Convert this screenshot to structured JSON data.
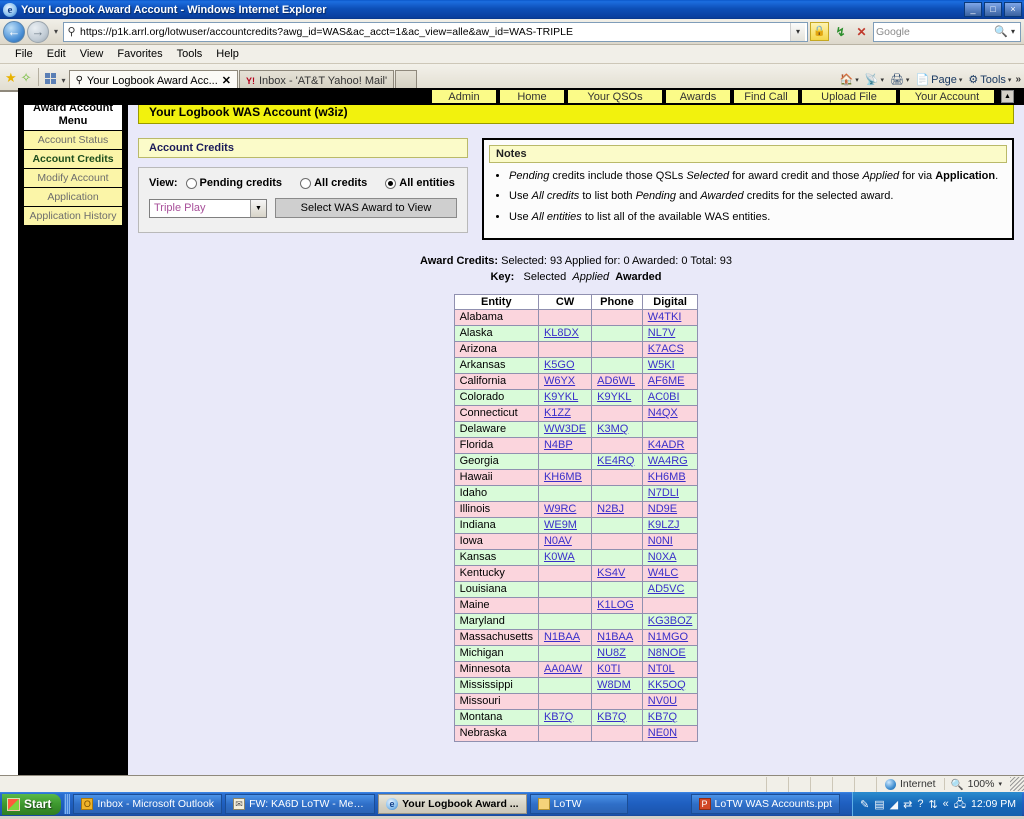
{
  "window": {
    "title": "Your Logbook Award Account - Windows Internet Explorer",
    "minimize": "_",
    "maximize": "□",
    "close": "×"
  },
  "address_bar": {
    "url": "https://p1k.arrl.org/lotwuser/accountcredits?awg_id=WAS&ac_acct=1&ac_view=alle&aw_id=WAS-TRIPLE",
    "search_placeholder": "Google"
  },
  "menu_bar": [
    "File",
    "Edit",
    "View",
    "Favorites",
    "Tools",
    "Help"
  ],
  "tabs": [
    {
      "label": "Your Logbook Award Acc...",
      "close": "✕",
      "active": true
    },
    {
      "label": "Inbox - 'AT&T Yahoo! Mail'",
      "close": "",
      "active": false
    }
  ],
  "command_bar": {
    "page_label": "Page",
    "tools_label": "Tools",
    "overflow": "»"
  },
  "nav_tabs": [
    "Admin",
    "Home",
    "Your QSOs",
    "Awards",
    "Find Call",
    "Upload File",
    "Your Account"
  ],
  "sidebar": {
    "title": "Award Account Menu",
    "items": [
      {
        "label": "Account Status",
        "current": false
      },
      {
        "label": "Account Credits",
        "current": true
      },
      {
        "label": "Modify Account",
        "current": false
      },
      {
        "label": "Application",
        "current": false
      },
      {
        "label": "Application History",
        "current": false
      }
    ]
  },
  "page_banner": "Your Logbook WAS Account (w3iz)",
  "account_credits": {
    "heading": "Account Credits",
    "view_label": "View:",
    "radios": [
      {
        "label": "Pending credits",
        "selected": false
      },
      {
        "label": "All credits",
        "selected": false
      },
      {
        "label": "All entities",
        "selected": true
      }
    ],
    "award_select_value": "Triple Play",
    "select_button": "Select WAS Award to View"
  },
  "notes": {
    "heading": "Notes",
    "items": [
      {
        "parts": [
          {
            "t": "Pending",
            "s": "i"
          },
          {
            "t": " credits include those QSLs ",
            "s": ""
          },
          {
            "t": "Selected",
            "s": "i"
          },
          {
            "t": " for award credit and those ",
            "s": ""
          },
          {
            "t": "Applied",
            "s": "i"
          },
          {
            "t": " for via ",
            "s": ""
          },
          {
            "t": "Application",
            "s": "b"
          },
          {
            "t": ".",
            "s": ""
          }
        ]
      },
      {
        "parts": [
          {
            "t": "Use ",
            "s": ""
          },
          {
            "t": "All credits",
            "s": "i"
          },
          {
            "t": " to list both ",
            "s": ""
          },
          {
            "t": "Pending",
            "s": "i"
          },
          {
            "t": " and ",
            "s": ""
          },
          {
            "t": "Awarded",
            "s": "i"
          },
          {
            "t": " credits for the selected award.",
            "s": ""
          }
        ]
      },
      {
        "parts": [
          {
            "t": "Use ",
            "s": ""
          },
          {
            "t": "All entities",
            "s": "i"
          },
          {
            "t": " to list all of the available WAS entities.",
            "s": ""
          }
        ]
      }
    ]
  },
  "award_credits_summary": {
    "label": "Award Credits:",
    "selected_label": "Selected:",
    "selected_value": "93",
    "applied_label": "Applied for:",
    "applied_value": "0",
    "awarded_label": "Awarded:",
    "awarded_value": "0",
    "total_label": "Total:",
    "total_value": "93",
    "key_label": "Key:",
    "key_selected": "Selected",
    "key_applied": "Applied",
    "key_awarded": "Awarded"
  },
  "entity_table": {
    "columns": [
      "Entity",
      "CW",
      "Phone",
      "Digital"
    ],
    "rows": [
      {
        "entity": "Alabama",
        "cw": "",
        "phone": "",
        "digital": "W4TKI"
      },
      {
        "entity": "Alaska",
        "cw": "KL8DX",
        "phone": "",
        "digital": "NL7V"
      },
      {
        "entity": "Arizona",
        "cw": "",
        "phone": "",
        "digital": "K7ACS"
      },
      {
        "entity": "Arkansas",
        "cw": "K5GO",
        "phone": "",
        "digital": "W5KI"
      },
      {
        "entity": "California",
        "cw": "W6YX",
        "phone": "AD6WL",
        "digital": "AF6ME"
      },
      {
        "entity": "Colorado",
        "cw": "K9YKL",
        "phone": "K9YKL",
        "digital": "AC0BI"
      },
      {
        "entity": "Connecticut",
        "cw": "K1ZZ",
        "phone": "",
        "digital": "N4QX"
      },
      {
        "entity": "Delaware",
        "cw": "WW3DE",
        "phone": "K3MQ",
        "digital": ""
      },
      {
        "entity": "Florida",
        "cw": "N4BP",
        "phone": "",
        "digital": "K4ADR"
      },
      {
        "entity": "Georgia",
        "cw": "",
        "phone": "KE4RQ",
        "digital": "WA4RG"
      },
      {
        "entity": "Hawaii",
        "cw": "KH6MB",
        "phone": "",
        "digital": "KH6MB"
      },
      {
        "entity": "Idaho",
        "cw": "",
        "phone": "",
        "digital": "N7DLI"
      },
      {
        "entity": "Illinois",
        "cw": "W9RC",
        "phone": "N2BJ",
        "digital": "ND9E"
      },
      {
        "entity": "Indiana",
        "cw": "WE9M",
        "phone": "",
        "digital": "K9LZJ"
      },
      {
        "entity": "Iowa",
        "cw": "N0AV",
        "phone": "",
        "digital": "N0NI"
      },
      {
        "entity": "Kansas",
        "cw": "K0WA",
        "phone": "",
        "digital": "N0XA"
      },
      {
        "entity": "Kentucky",
        "cw": "",
        "phone": "KS4V",
        "digital": "W4LC"
      },
      {
        "entity": "Louisiana",
        "cw": "",
        "phone": "",
        "digital": "AD5VC"
      },
      {
        "entity": "Maine",
        "cw": "",
        "phone": "K1LOG",
        "digital": ""
      },
      {
        "entity": "Maryland",
        "cw": "",
        "phone": "",
        "digital": "KG3BOZ"
      },
      {
        "entity": "Massachusetts",
        "cw": "N1BAA",
        "phone": "N1BAA",
        "digital": "N1MGO"
      },
      {
        "entity": "Michigan",
        "cw": "",
        "phone": "NU8Z",
        "digital": "N8NOE"
      },
      {
        "entity": "Minnesota",
        "cw": "AA0AW",
        "phone": "K0TI",
        "digital": "NT0L"
      },
      {
        "entity": "Mississippi",
        "cw": "",
        "phone": "W8DM",
        "digital": "KK5OQ"
      },
      {
        "entity": "Missouri",
        "cw": "",
        "phone": "",
        "digital": "NV0U"
      },
      {
        "entity": "Montana",
        "cw": "KB7Q",
        "phone": "KB7Q",
        "digital": "KB7Q"
      },
      {
        "entity": "Nebraska",
        "cw": "",
        "phone": "",
        "digital": "NE0N"
      }
    ]
  },
  "status_bar": {
    "zone": "Internet",
    "zoom": "100%",
    "zoom_caret": "▾"
  },
  "taskbar": {
    "start": "Start",
    "items": [
      {
        "label": "Inbox - Microsoft Outlook",
        "icon": "outlook-icon",
        "active": false
      },
      {
        "label": "FW: KA6D LoTW - Messa...",
        "icon": "mail-icon",
        "active": false
      },
      {
        "label": "Your Logbook Award ...",
        "icon": "ie-icon",
        "active": true
      },
      {
        "label": "LoTW",
        "icon": "folder-icon",
        "active": false
      },
      {
        "label": "LoTW WAS Accounts.ppt",
        "icon": "powerpoint-icon",
        "active": false
      }
    ],
    "tray_icons": [
      "pen-icon",
      "tablet-icon",
      "speaker-icon",
      "network-icon",
      "help-icon",
      "updown-icon"
    ],
    "tray_chevron": "«",
    "clock": "12:09 PM"
  },
  "colors": {
    "banner_yellow": "#f2f20d",
    "menu_yellow": "#fbf5a8",
    "row_odd_pink": "#fbd5dd",
    "row_even_green": "#d9fbd9",
    "link_blue": "#3a2fc9"
  }
}
